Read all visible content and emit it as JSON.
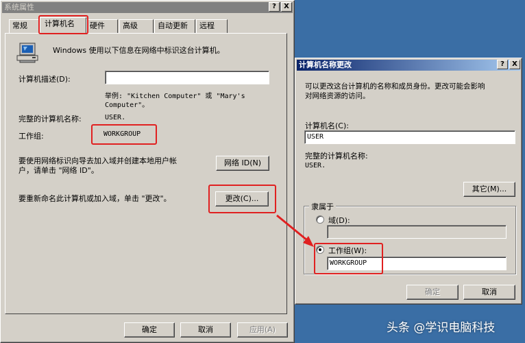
{
  "left_window": {
    "title": "系统属性",
    "help_btn": "?",
    "close_btn": "X",
    "tabs": [
      "常规",
      "计算机名",
      "硬件",
      "高级",
      "自动更新",
      "远程"
    ],
    "info_text": "Windows 使用以下信息在网络中标识这台计算机。",
    "desc_label": "计算机描述(D):",
    "desc_value": "",
    "example_line1": "举例: \"Kitchen Computer\" 或 \"Mary's",
    "example_line2": "Computer\"。",
    "fullname_label": "完整的计算机名称:",
    "fullname_value": "USER.",
    "workgroup_label": "工作组:",
    "workgroup_value": "WORKGROUP",
    "network_text_line1": "要使用网络标识向导去加入域并创建本地用户帐",
    "network_text_line2": "户，请单击 \"网络 ID\"。",
    "network_id_btn": "网络 ID(N)",
    "rename_text": "要重新命名此计算机或加入域，单击 \"更改\"。",
    "change_btn": "更改(C)...",
    "ok_btn": "确定",
    "cancel_btn": "取消",
    "apply_btn": "应用(A)"
  },
  "right_window": {
    "title": "计算机名称更改",
    "help_btn": "?",
    "close_btn": "X",
    "info_line1": "可以更改这台计算机的名称和成员身份。更改可能会影响",
    "info_line2": "对网络资源的访问。",
    "name_label": "计算机名(C):",
    "name_value": "USER",
    "fullname_label": "完整的计算机名称:",
    "fullname_value": "USER.",
    "more_btn": "其它(M)...",
    "member_group": "隶属于",
    "domain_radio": "域(D):",
    "domain_value": "",
    "workgroup_radio": "工作组(W):",
    "workgroup_value": "WORKGROUP",
    "ok_btn": "确定",
    "cancel_btn": "取消"
  },
  "watermark": "头条 @学识电脑科技",
  "colors": {
    "desktop": "#3a6ea5",
    "dialog": "#d4d0c8",
    "annotation": "#e02020",
    "title_active": "#0a246a"
  }
}
